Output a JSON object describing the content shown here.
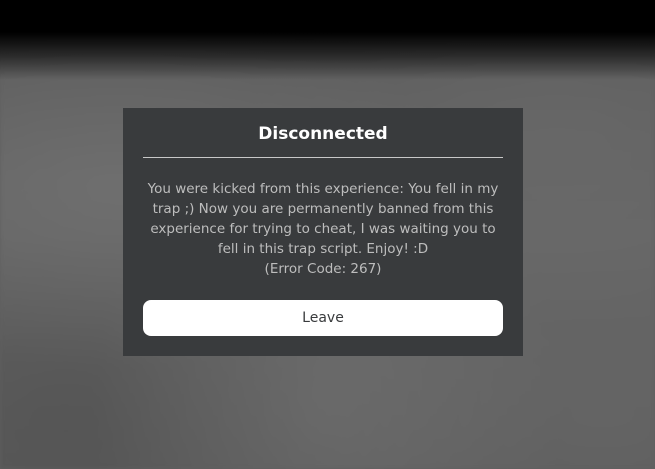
{
  "dialog": {
    "title": "Disconnected",
    "message_lines": [
      "You were kicked from this experience: You fell in my",
      "trap ;) Now you are permanently banned from this",
      "experience for trying to cheat, I was waiting you to",
      "fell in this trap script. Enjoy! :D"
    ],
    "error_code": "(Error Code: 267)",
    "leave_label": "Leave"
  },
  "colors": {
    "dialog_background": "#393b3d",
    "title_text": "#ffffff",
    "message_text": "#bdbdbd",
    "button_background": "#ffffff",
    "button_text": "#393b3d"
  }
}
